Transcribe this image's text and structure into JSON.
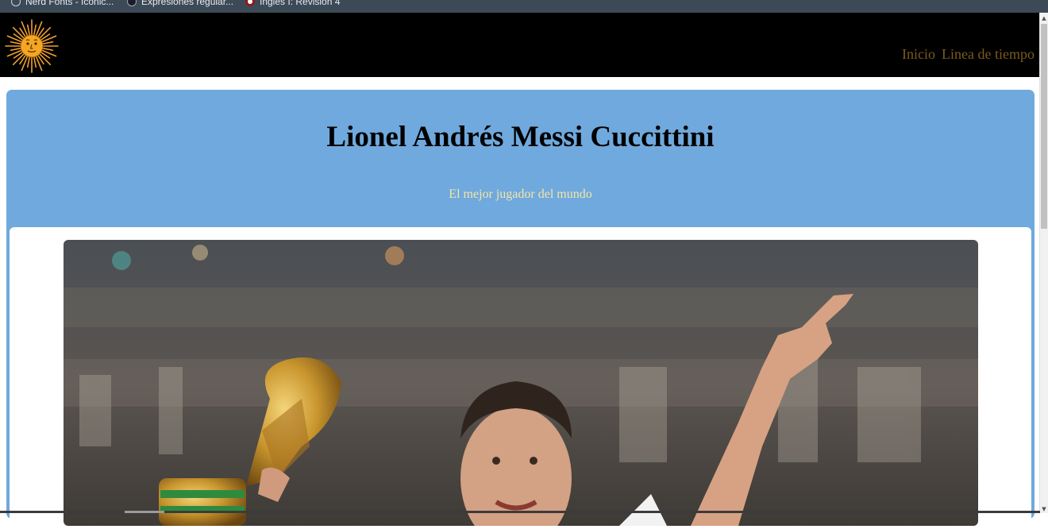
{
  "bookmarks": [
    {
      "label": "Nerd Fonts - Iconic...",
      "icon": "circle-icon"
    },
    {
      "label": "Expresiones regular...",
      "icon": "regex-site-icon"
    },
    {
      "label": "Inglés I: Revisión 4",
      "icon": "course-icon"
    }
  ],
  "header": {
    "logo_icon": "sun-of-may-icon",
    "nav": [
      {
        "label": "Inicio"
      },
      {
        "label": "Linea de tiempo"
      }
    ],
    "background": "#000000",
    "link_color": "#7a5a1e"
  },
  "hero": {
    "title": "Lionel Andrés Messi Cuccittini",
    "subtitle": "El mejor jugador del mundo",
    "background": "#70a9dd",
    "subtitle_color": "#f3e6a8",
    "image_icon": "messi-trophy-photo"
  }
}
